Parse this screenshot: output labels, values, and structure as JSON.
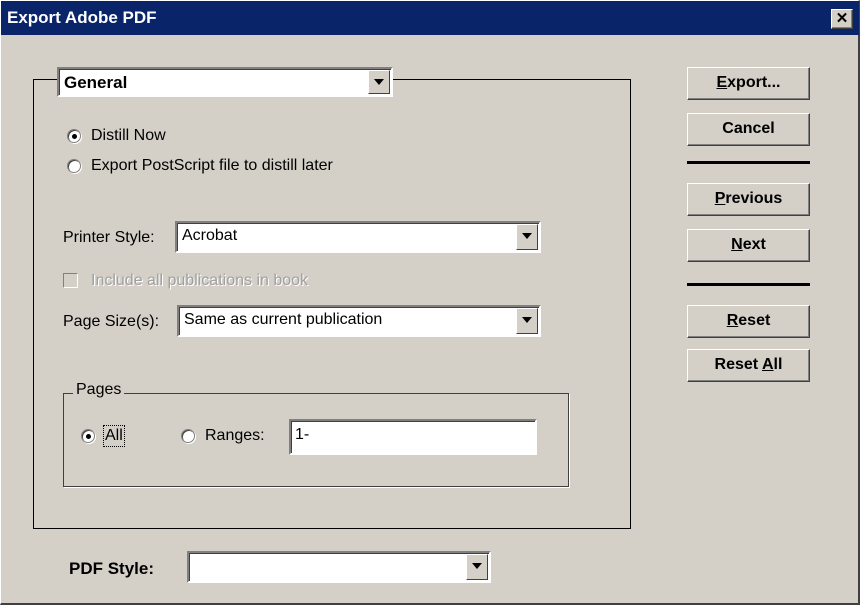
{
  "window": {
    "title": "Export Adobe PDF",
    "close_label": "✕"
  },
  "section_combo": {
    "value": "General"
  },
  "distill": {
    "now_label": "Distill Now",
    "later_label": "Export PostScript file to distill later",
    "selected": "now"
  },
  "printer_style": {
    "label": "Printer Style:",
    "value": "Acrobat"
  },
  "include_book": {
    "label": "Include all publications in book",
    "checked": false,
    "enabled": false
  },
  "page_size": {
    "label": "Page Size(s):",
    "value": "Same as current publication"
  },
  "pages": {
    "legend": "Pages",
    "all_label": "All",
    "ranges_label": "Ranges:",
    "ranges_value": "1-",
    "selected": "all"
  },
  "pdf_style": {
    "label": "PDF Style:",
    "value": ""
  },
  "buttons": {
    "export": {
      "pre": "",
      "key": "E",
      "post": "xport..."
    },
    "cancel": "Cancel",
    "previous": {
      "pre": "",
      "key": "P",
      "post": "revious"
    },
    "next": {
      "pre": "",
      "key": "N",
      "post": "ext"
    },
    "reset": {
      "pre": "",
      "key": "R",
      "post": "eset"
    },
    "reset_all": {
      "pre": "Reset ",
      "key": "A",
      "post": "ll"
    }
  }
}
